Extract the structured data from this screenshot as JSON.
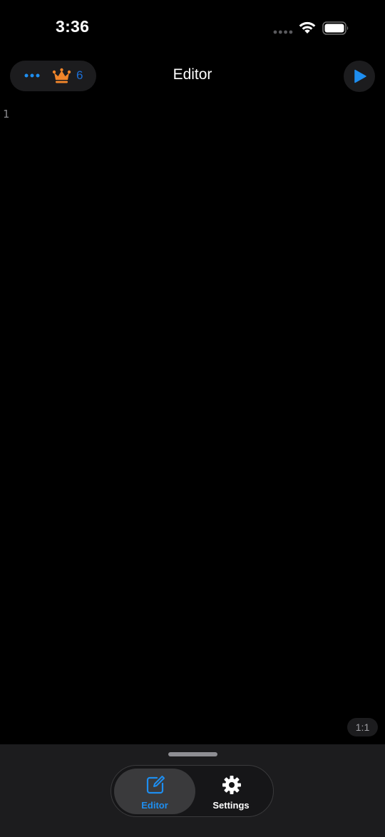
{
  "status_bar": {
    "time": "3:36"
  },
  "nav": {
    "title": "Editor",
    "premium_count": "6",
    "icons": [
      "more-icon",
      "crown-icon",
      "play-icon"
    ]
  },
  "editor": {
    "line_numbers": [
      "1"
    ],
    "content": "",
    "cursor_position": "1:1"
  },
  "tabs": [
    {
      "label": "Editor",
      "icon": "compose-icon",
      "active": true
    },
    {
      "label": "Settings",
      "icon": "gear-icon",
      "active": false
    }
  ],
  "colors": {
    "accent": "#1e8ef0",
    "crown": "#f0852a",
    "background": "#000000",
    "surface": "#1c1c1e"
  }
}
